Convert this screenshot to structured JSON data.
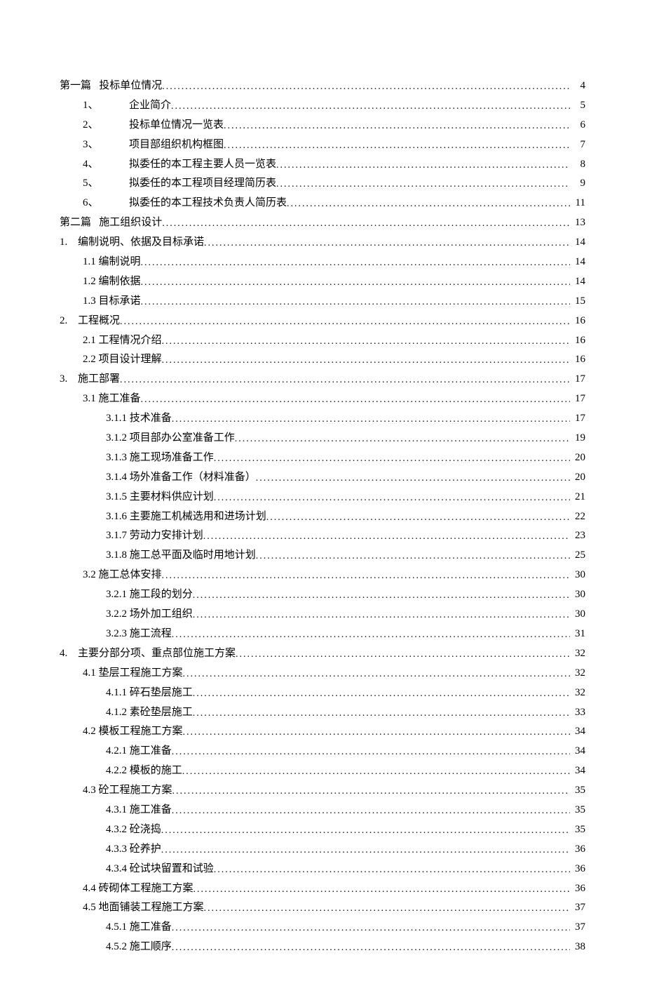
{
  "toc": [
    {
      "level": 0,
      "label": "第一篇",
      "title": "投标单位情况",
      "page": "4"
    },
    {
      "level": 1,
      "label": "1、",
      "title": "企业简介",
      "page": "5"
    },
    {
      "level": 1,
      "label": "2、",
      "title": "投标单位情况一览表",
      "page": "6"
    },
    {
      "level": 1,
      "label": "3、",
      "title": "项目部组织机构框图",
      "page": "7"
    },
    {
      "level": 1,
      "label": "4、",
      "title": "拟委任的本工程主要人员一览表",
      "page": "8"
    },
    {
      "level": 1,
      "label": "5、",
      "title": "拟委任的本工程项目经理简历表",
      "page": "9"
    },
    {
      "level": 1,
      "label": "6、",
      "title": "拟委任的本工程技术负责人简历表",
      "page": "11"
    },
    {
      "level": 0,
      "label": "第二篇",
      "title": "施工组织设计",
      "page": "13"
    },
    {
      "level": 0,
      "label": "1.",
      "title": "编制说明、依据及目标承诺",
      "page": "14",
      "num": true
    },
    {
      "level": 2,
      "label": "",
      "title": "1.1 编制说明",
      "page": "14"
    },
    {
      "level": 2,
      "label": "",
      "title": "1.2 编制依据",
      "page": "14"
    },
    {
      "level": 2,
      "label": "",
      "title": "1.3 目标承诺",
      "page": "15"
    },
    {
      "level": 0,
      "label": "2.",
      "title": "工程概况",
      "page": "16",
      "num": true
    },
    {
      "level": 2,
      "label": "",
      "title": "2.1 工程情况介绍",
      "page": "16"
    },
    {
      "level": 2,
      "label": "",
      "title": "2.2 项目设计理解",
      "page": "16"
    },
    {
      "level": 0,
      "label": "3.",
      "title": "施工部署",
      "page": "17",
      "num": true
    },
    {
      "level": 2,
      "label": "",
      "title": "3.1 施工准备",
      "page": "17"
    },
    {
      "level": 3,
      "label": "",
      "title": "3.1.1 技术准备",
      "page": "17"
    },
    {
      "level": 3,
      "label": "",
      "title": "3.1.2 项目部办公室准备工作",
      "page": "19"
    },
    {
      "level": 3,
      "label": "",
      "title": "3.1.3 施工现场准备工作",
      "page": "20"
    },
    {
      "level": 3,
      "label": "",
      "title": "3.1.4 场外准备工作（材料准备）",
      "page": "20"
    },
    {
      "level": 3,
      "label": "",
      "title": "3.1.5 主要材料供应计划",
      "page": "21"
    },
    {
      "level": 3,
      "label": "",
      "title": "3.1.6 主要施工机械选用和进场计划",
      "page": "22"
    },
    {
      "level": 3,
      "label": "",
      "title": "3.1.7 劳动力安排计划",
      "page": "23"
    },
    {
      "level": 3,
      "label": "",
      "title": "3.1.8 施工总平面及临时用地计划",
      "page": "25"
    },
    {
      "level": 2,
      "label": "",
      "title": "3.2 施工总体安排",
      "page": "30"
    },
    {
      "level": 3,
      "label": "",
      "title": "3.2.1 施工段的划分",
      "page": "30"
    },
    {
      "level": 3,
      "label": "",
      "title": "3.2.2 场外加工组织",
      "page": "30"
    },
    {
      "level": 3,
      "label": "",
      "title": "3.2.3 施工流程",
      "page": "31"
    },
    {
      "level": 0,
      "label": "4.",
      "title": "主要分部分项、重点部位施工方案",
      "page": "32",
      "num": true
    },
    {
      "level": 2,
      "label": "",
      "title": "4.1 垫层工程施工方案",
      "page": "32"
    },
    {
      "level": 3,
      "label": "",
      "title": "4.1.1 碎石垫层施工",
      "page": "32"
    },
    {
      "level": 3,
      "label": "",
      "title": "4.1.2 素砼垫层施工",
      "page": "33"
    },
    {
      "level": 2,
      "label": "",
      "title": "4.2 模板工程施工方案",
      "page": "34"
    },
    {
      "level": 3,
      "label": "",
      "title": "4.2.1 施工准备",
      "page": "34"
    },
    {
      "level": 3,
      "label": "",
      "title": "4.2.2 模板的施工",
      "page": "34"
    },
    {
      "level": 2,
      "label": "",
      "title": "4.3 砼工程施工方案",
      "page": "35"
    },
    {
      "level": 3,
      "label": "",
      "title": "4.3.1 施工准备",
      "page": "35"
    },
    {
      "level": 3,
      "label": "",
      "title": "4.3.2 砼浇捣",
      "page": "35"
    },
    {
      "level": 3,
      "label": "",
      "title": "4.3.3 砼养护",
      "page": "36"
    },
    {
      "level": 3,
      "label": "",
      "title": "4.3.4 砼试块留置和试验",
      "page": "36"
    },
    {
      "level": 2,
      "label": "",
      "title": "4.4 砖砌体工程施工方案",
      "page": "36"
    },
    {
      "level": 2,
      "label": "",
      "title": "4.5 地面铺装工程施工方案",
      "page": "37"
    },
    {
      "level": 3,
      "label": "",
      "title": "4.5.1 施工准备",
      "page": "37"
    },
    {
      "level": 3,
      "label": "",
      "title": "4.5.2 施工顺序",
      "page": "38"
    }
  ]
}
